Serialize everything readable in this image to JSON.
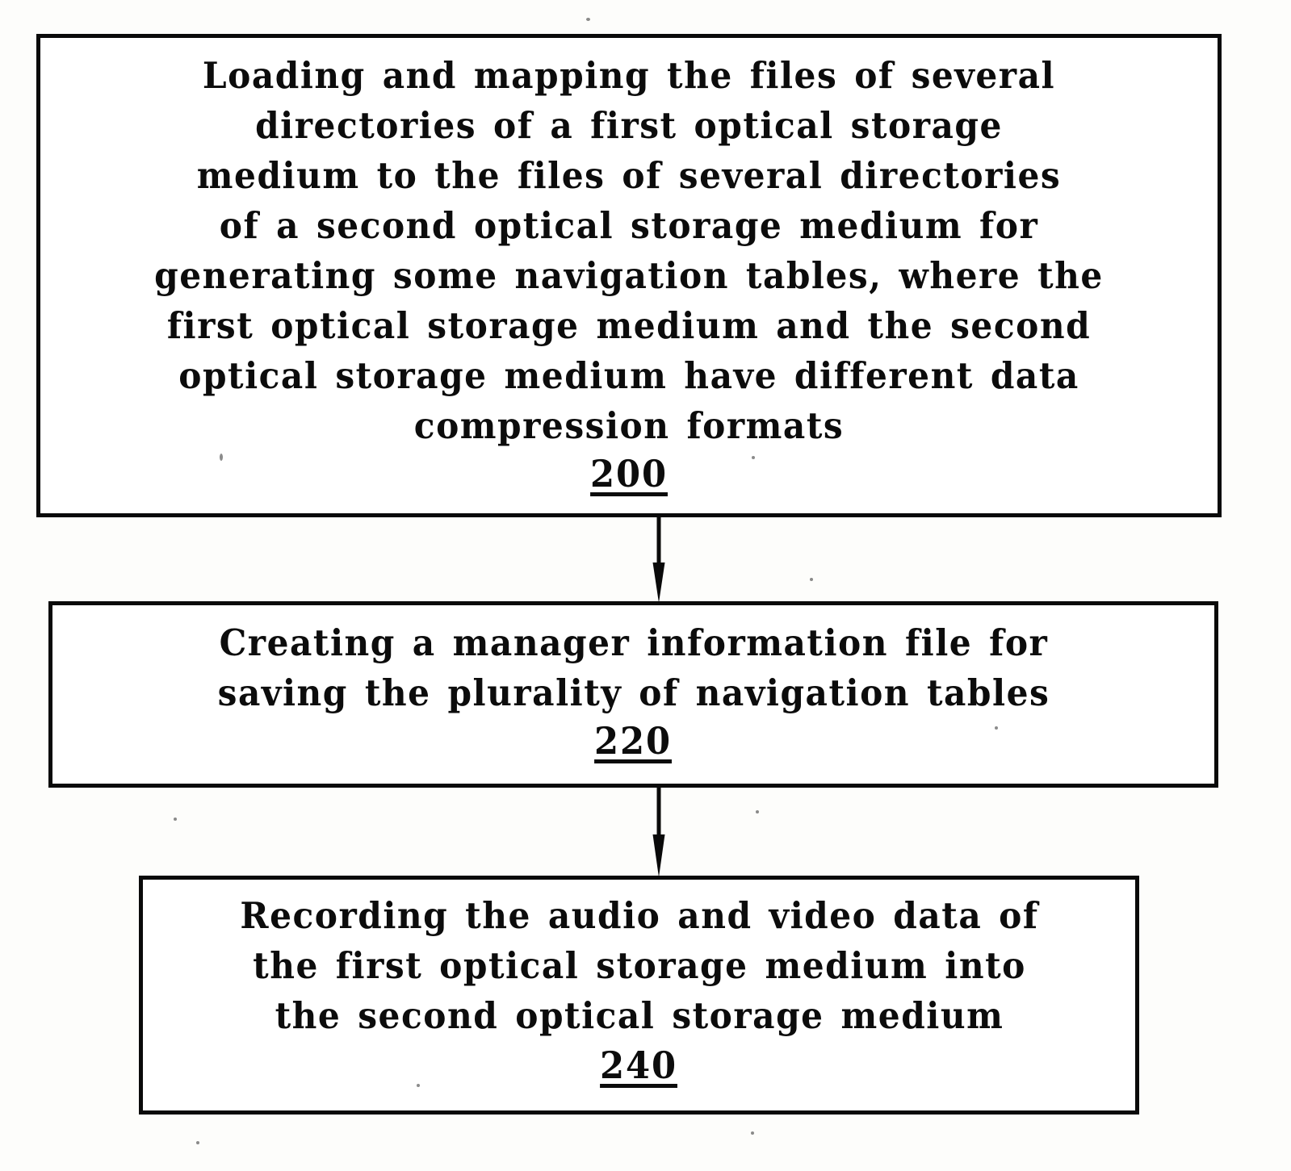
{
  "figure": {
    "type": "patent-process-flowchart",
    "orientation": "vertical",
    "background_color": "#fdfdfb",
    "line_color": "#0a0a0a",
    "text_color": "#0c0c0c"
  },
  "steps": [
    {
      "id": "step-200",
      "reference_numeral": "200",
      "text": "Loading and mapping the files of several\ndirectories of a first optical storage\nmedium to the files of several directories\nof a second optical storage medium for\ngenerating some navigation tables, where the\nfirst optical storage medium and the second\noptical storage medium have different data\ncompression formats"
    },
    {
      "id": "step-220",
      "reference_numeral": "220",
      "text": "Creating a manager information file for\nsaving the plurality of navigation tables"
    },
    {
      "id": "step-240",
      "reference_numeral": "240",
      "text": "Recording the audio and video data of\nthe first optical storage medium into\nthe second optical storage medium"
    }
  ],
  "connectors": [
    {
      "id": "connector-200-220",
      "from": "step-200",
      "to": "step-220",
      "style": "solid-line-with-arrowhead",
      "direction": "down"
    },
    {
      "id": "connector-220-240",
      "from": "step-220",
      "to": "step-240",
      "style": "solid-line-with-arrowhead",
      "direction": "down"
    }
  ]
}
